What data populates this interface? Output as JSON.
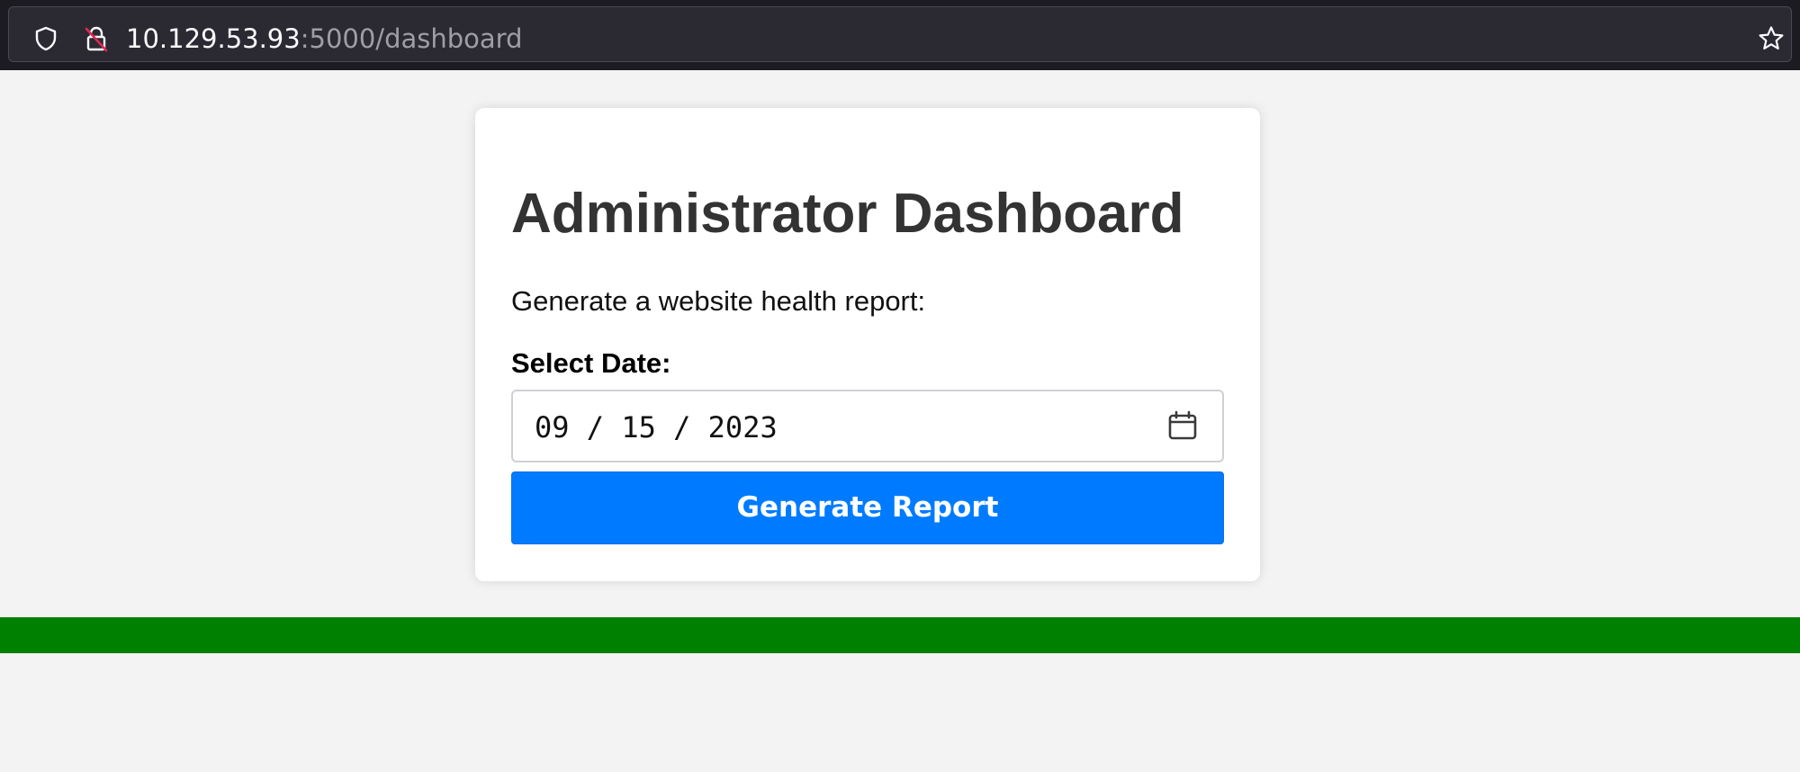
{
  "browser": {
    "url_host": "10.129.53.93",
    "url_path": ":5000/dashboard",
    "icons": {
      "tracking": "shield-icon",
      "security": "insecure-lock-icon",
      "bookmark": "star-icon"
    }
  },
  "dashboard": {
    "title": "Administrator Dashboard",
    "description": "Generate a website health report:",
    "date_label": "Select Date:",
    "date_value": "09 / 15 / 2023",
    "button_label": "Generate Report"
  },
  "colors": {
    "button": "#007bff",
    "status_bar": "#008000",
    "page_background": "#f3f3f3",
    "browser_chrome": "#1c1b22"
  }
}
